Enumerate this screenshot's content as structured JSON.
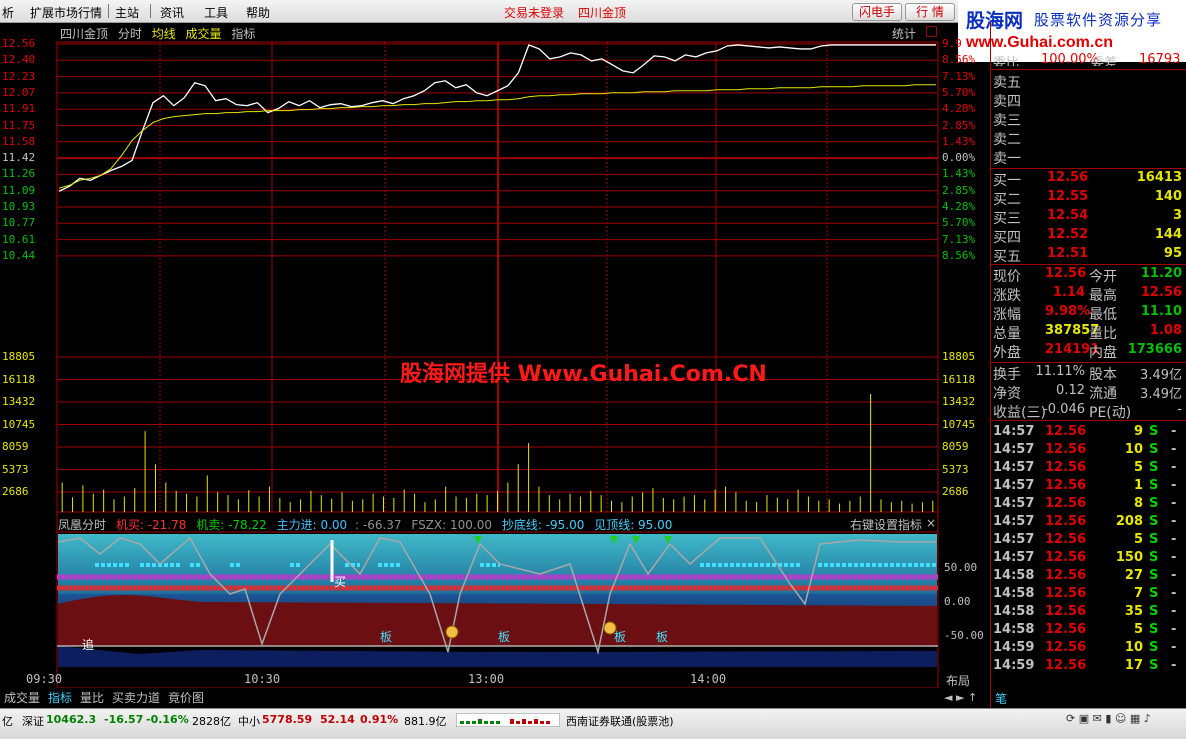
{
  "menu": {
    "items": [
      "析",
      "扩展市场行情",
      "主站",
      "资讯",
      "工具",
      "帮助"
    ],
    "login_status": "交易未登录",
    "stock_title": "四川金顶",
    "btn_flash": "闪电手",
    "btn_quote": "行  情",
    "logo_name": "股海网",
    "logo_slogan": "股票软件资源分享",
    "logo_url": "www.Guhai.com.cn"
  },
  "chart": {
    "stock_name": "四川金顶",
    "tab_minute": "分时",
    "legend_avg": "均线",
    "legend_vol": "成交量",
    "legend_ind": "指标",
    "stats_btn": "统计",
    "watermark": "股海网提供 Www.Guhai.Com.CN",
    "colors": {
      "up": "#e00000",
      "down": "#00c000",
      "flat": "#c0c0c0",
      "grid": "#a00000",
      "avg": "#e6e600"
    },
    "price_ticks": [
      "12.56",
      "12.40",
      "12.23",
      "12.07",
      "11.91",
      "11.75",
      "11.58",
      "11.42",
      "11.26",
      "11.09",
      "10.93",
      "10.77",
      "10.61",
      "10.44"
    ],
    "pct_ticks": [
      "9.9",
      "8.56%",
      "7.13%",
      "5.70%",
      "4.28%",
      "2.85%",
      "1.43%",
      "0.00%",
      "1.43%",
      "2.85%",
      "4.28%",
      "5.70%",
      "7.13%",
      "8.56%"
    ],
    "vol_ticks": [
      "18805",
      "16118",
      "13432",
      "10745",
      "8059",
      "5373",
      "2686"
    ],
    "time_ticks": [
      "09:30",
      "10:30",
      "13:00",
      "14:00"
    ],
    "layout_btn": "布局"
  },
  "chart_data": {
    "type": "line",
    "title": "四川金顶",
    "prev_close": 11.42,
    "ylim": [
      10.36,
      12.64
    ],
    "price_series": [
      11.09,
      11.14,
      11.22,
      11.2,
      11.25,
      11.3,
      11.34,
      11.4,
      11.7,
      11.98,
      12.05,
      11.95,
      12.03,
      12.18,
      12.15,
      12.0,
      12.02,
      11.96,
      11.95,
      11.98,
      11.88,
      11.92,
      11.99,
      11.95,
      12.0,
      11.93,
      11.96,
      11.97,
      11.94,
      11.95,
      11.98,
      12.0,
      11.97,
      12.02,
      12.05,
      12.1,
      12.18,
      12.2,
      12.13,
      12.16,
      12.08,
      12.05,
      12.1,
      12.15,
      12.28,
      12.56,
      12.52,
      12.42,
      12.44,
      12.48,
      12.46,
      12.4,
      12.42,
      12.36,
      12.3,
      12.28,
      12.36,
      12.45,
      12.44,
      12.4,
      12.46,
      12.44,
      12.48,
      12.5,
      12.55,
      12.56,
      12.55,
      12.54,
      12.53,
      12.54,
      12.53,
      12.52,
      12.52,
      12.55,
      12.56,
      12.56,
      12.56,
      12.56,
      12.56,
      12.56,
      12.56,
      12.56,
      12.56,
      12.56,
      12.56
    ],
    "avg_series": [
      11.12,
      11.15,
      11.2,
      11.22,
      11.25,
      11.32,
      11.45,
      11.6,
      11.7,
      11.78,
      11.82,
      11.84,
      11.85,
      11.86,
      11.87,
      11.87,
      11.88,
      11.88,
      11.89,
      11.89,
      11.9,
      11.9,
      11.9,
      11.91,
      11.91,
      11.92,
      11.92,
      11.93,
      11.93,
      11.94,
      11.94,
      11.95,
      11.95,
      11.96,
      11.96,
      11.97,
      11.97,
      11.98,
      11.99,
      11.99,
      12.0,
      12.0,
      12.01,
      12.01,
      12.02,
      12.04,
      12.05,
      12.05,
      12.06,
      12.06,
      12.07,
      12.07,
      12.07,
      12.08,
      12.08,
      12.08,
      12.09,
      12.09,
      12.09,
      12.1,
      12.1,
      12.1,
      12.1,
      12.11,
      12.11,
      12.11,
      12.12,
      12.12,
      12.12,
      12.13,
      12.13,
      12.13,
      12.13,
      12.14,
      12.14,
      12.14,
      12.14,
      12.15,
      12.15,
      12.15,
      12.15,
      12.15,
      12.16,
      12.16,
      12.16
    ],
    "volume_series": [
      4200,
      2100,
      3800,
      2600,
      3200,
      1800,
      2200,
      3400,
      11500,
      6800,
      4200,
      3000,
      2600,
      2200,
      5200,
      2800,
      2400,
      1800,
      3100,
      2200,
      3600,
      2000,
      1400,
      1800,
      3000,
      2400,
      1900,
      2800,
      1600,
      1800,
      2600,
      2200,
      2000,
      3200,
      2600,
      1400,
      1800,
      3600,
      2200,
      2000,
      2600,
      2400,
      3000,
      4200,
      6800,
      9800,
      3600,
      2400,
      1800,
      2600,
      2200,
      3000,
      2400,
      1600,
      1400,
      2200,
      2800,
      3400,
      2000,
      1800,
      2200,
      2400,
      1800,
      3200,
      3600,
      2800,
      1600,
      1400,
      2400,
      2000,
      1800,
      3200,
      2200,
      1600,
      1800,
      1200,
      1600,
      2200,
      16800,
      1800,
      1400,
      1600,
      1200,
      1400,
      1600
    ]
  },
  "indicator": {
    "title": "凤凰分时",
    "jimai_label": "机买: -21.78",
    "jimaichu_label": "机卖: -78.22",
    "zhuli_label": "主力进: 0.00",
    "fsnum_label": ": -66.37",
    "fszx_label": "FSZX: 100.00",
    "chaodi_label": "抄底线: -95.00",
    "jianding_label": "见顶线: 95.00",
    "settings_btn": "右键设置指标",
    "close_glyph": "×",
    "ticks": [
      "50.00",
      "0.00",
      "-50.00"
    ],
    "mark_board": "板",
    "mark_chase": "追",
    "mark_buy": "买"
  },
  "quote": {
    "header_left": "委比",
    "header_value": "100.00%",
    "header_mid": "委差",
    "header_right": "16793",
    "asks": [
      {
        "label": "卖五"
      },
      {
        "label": "卖四"
      },
      {
        "label": "卖三"
      },
      {
        "label": "卖二"
      },
      {
        "label": "卖一"
      }
    ],
    "bids": [
      {
        "label": "买一",
        "price": "12.56",
        "vol": "16413"
      },
      {
        "label": "买二",
        "price": "12.55",
        "vol": "140"
      },
      {
        "label": "买三",
        "price": "12.54",
        "vol": "3"
      },
      {
        "label": "买四",
        "price": "12.52",
        "vol": "144"
      },
      {
        "label": "买五",
        "price": "12.51",
        "vol": "95"
      }
    ],
    "stats": [
      {
        "l1": "现价",
        "v1": "12.56",
        "l2": "今开",
        "v2": "11.20",
        "c1": "#e00000",
        "c2": "#00c000"
      },
      {
        "l1": "涨跌",
        "v1": "1.14",
        "l2": "最高",
        "v2": "12.56",
        "c1": "#e00000",
        "c2": "#e00000"
      },
      {
        "l1": "涨幅",
        "v1": "9.98%",
        "l2": "最低",
        "v2": "11.10",
        "c1": "#e00000",
        "c2": "#00c000"
      },
      {
        "l1": "总量",
        "v1": "387857",
        "l2": "量比",
        "v2": "1.08",
        "c1": "#e6e600",
        "c2": "#e00000"
      },
      {
        "l1": "外盘",
        "v1": "214191",
        "l2": "内盘",
        "v2": "173666",
        "c1": "#e00000",
        "c2": "#00c000"
      }
    ],
    "stats2": [
      {
        "l1": "换手",
        "v1": "11.11%",
        "l2": "股本",
        "v2": "3.49亿"
      },
      {
        "l1": "净资",
        "v1": "0.12",
        "l2": "流通",
        "v2": "3.49亿"
      },
      {
        "l1": "收益(三)",
        "v1": "-0.046",
        "l2": "PE(动)",
        "v2": "-"
      }
    ],
    "ticks": [
      {
        "t": "14:57",
        "p": "12.56",
        "v": "9",
        "s": "S"
      },
      {
        "t": "14:57",
        "p": "12.56",
        "v": "10",
        "s": "S"
      },
      {
        "t": "14:57",
        "p": "12.56",
        "v": "5",
        "s": "S"
      },
      {
        "t": "14:57",
        "p": "12.56",
        "v": "1",
        "s": "S"
      },
      {
        "t": "14:57",
        "p": "12.56",
        "v": "8",
        "s": "S"
      },
      {
        "t": "14:57",
        "p": "12.56",
        "v": "208",
        "s": "S"
      },
      {
        "t": "14:57",
        "p": "12.56",
        "v": "5",
        "s": "S"
      },
      {
        "t": "14:57",
        "p": "12.56",
        "v": "150",
        "s": "S"
      },
      {
        "t": "14:58",
        "p": "12.56",
        "v": "27",
        "s": "S"
      },
      {
        "t": "14:58",
        "p": "12.56",
        "v": "7",
        "s": "S"
      },
      {
        "t": "14:58",
        "p": "12.56",
        "v": "35",
        "s": "S"
      },
      {
        "t": "14:58",
        "p": "12.56",
        "v": "5",
        "s": "S"
      },
      {
        "t": "14:59",
        "p": "12.56",
        "v": "10",
        "s": "S"
      },
      {
        "t": "14:59",
        "p": "12.56",
        "v": "17",
        "s": "S"
      }
    ],
    "tick_dash": "-",
    "panel_tab": "笔"
  },
  "bottom_tabs": [
    "成交量",
    "指标",
    "量比",
    "买卖力道",
    "竟价图"
  ],
  "status": {
    "left_unit": "亿",
    "sz_label": "深证",
    "sz_value": "10462.3",
    "sz_change": "-16.57",
    "sz_pct": "-0.16%",
    "sz_amount": "2828亿",
    "zx_label": "中小",
    "zx_value": "5778.59",
    "zx_change": "52.14",
    "zx_pct": "0.91%",
    "zx_amount": "881.9亿",
    "broker": "西南证券联通(股票池)"
  }
}
